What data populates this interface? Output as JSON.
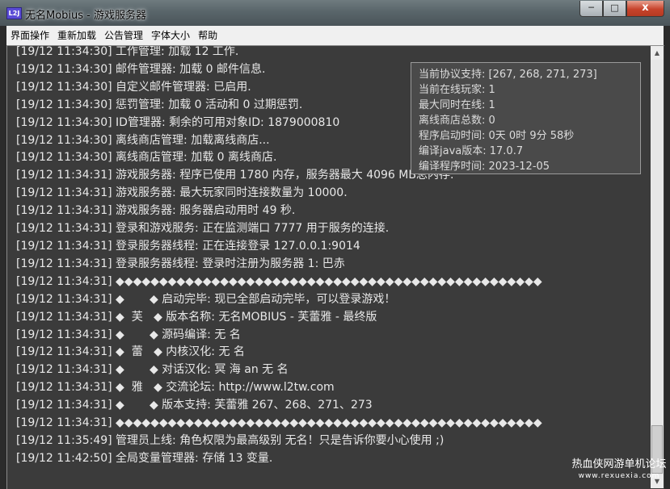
{
  "window": {
    "title": "无名Mobius - 游戏服务器",
    "icon_text": "L2J",
    "minimize": "─",
    "maximize": "□",
    "close": "x"
  },
  "menu": [
    {
      "label": "界面操作"
    },
    {
      "label": "重新加载"
    },
    {
      "label": "公告管理"
    },
    {
      "label": "字体大小"
    },
    {
      "label": "帮助"
    }
  ],
  "log": [
    "[19/12 11:34:30] 工作管理: 加载 12 工作.",
    "[19/12 11:34:30] 邮件管理器: 加载 0 邮件信息.",
    "[19/12 11:34:30] 自定义邮件管理器: 已启用.",
    "[19/12 11:34:30] 惩罚管理: 加载 0 活动和 0 过期惩罚.",
    "[19/12 11:34:30] ID管理器: 剩余的可用对象ID: 1879000810",
    "[19/12 11:34:30] 离线商店管理: 加载离线商店...",
    "[19/12 11:34:30] 离线商店管理: 加载 0 离线商店.",
    "[19/12 11:34:31] 游戏服务器: 程序已使用 1780 内存，服务器最大 4096 MB总内存.",
    "[19/12 11:34:31] 游戏服务器: 最大玩家同时连接数量为 10000.",
    "[19/12 11:34:31] 游戏服务器: 服务器启动用时 49 秒.",
    "[19/12 11:34:31] 登录和游戏服务: 正在监测端口 7777 用于服务的连接.",
    "[19/12 11:34:31] 登录服务器线程: 正在连接登录 127.0.0.1:9014",
    "[19/12 11:34:31] 登录服务器线程: 登录时注册为服务器 1: 巴赤",
    "[19/12 11:34:31] ◆◆◆◆◆◆◆◆◆◆◆◆◆◆◆◆◆◆◆◆◆◆◆◆◆◆◆◆◆◆◆◆◆◆◆◆◆◆◆◆◆◆◆◆◆◆◆◆◆",
    "[19/12 11:34:31] ◆       ◆ 启动完毕: 现已全部启动完毕，可以登录游戏！",
    "[19/12 11:34:31] ◆  芙   ◆ 版本名称: 无名MOBIUS - 芙蕾雅 - 最终版",
    "[19/12 11:34:31] ◆       ◆ 源码编译: 无 名",
    "[19/12 11:34:31] ◆  蕾   ◆ 内核汉化: 无 名",
    "[19/12 11:34:31] ◆       ◆ 对话汉化: 冥 海 an 无 名",
    "[19/12 11:34:31] ◆  雅   ◆ 交流论坛: http://www.l2tw.com",
    "[19/12 11:34:31] ◆       ◆ 版本支持: 芙蕾雅 267、268、271、273",
    "[19/12 11:34:31] ◆◆◆◆◆◆◆◆◆◆◆◆◆◆◆◆◆◆◆◆◆◆◆◆◆◆◆◆◆◆◆◆◆◆◆◆◆◆◆◆◆◆◆◆◆◆◆◆◆",
    "[19/12 11:35:49] 管理员上线: 角色权限为最高级别 无名！只是告诉你要小心使用 ;)",
    "[19/12 11:42:50] 全局变量管理器: 存储 13 变量."
  ],
  "status": [
    "当前协议支持: [267, 268, 271, 273]",
    "当前在线玩家: 1",
    "最大同时在线: 1",
    "离线商店总数: 0",
    "程序启动时间: 0天 0时 9分 58秒",
    "编译java版本: 17.0.7",
    "编译程序时间: 2023-12-05"
  ],
  "watermark": {
    "main": "热血侠网游单机论坛",
    "sub": "www.rexuexia.com"
  },
  "scrollbar": {
    "up_arrow": "▲",
    "down_arrow": "▼"
  }
}
